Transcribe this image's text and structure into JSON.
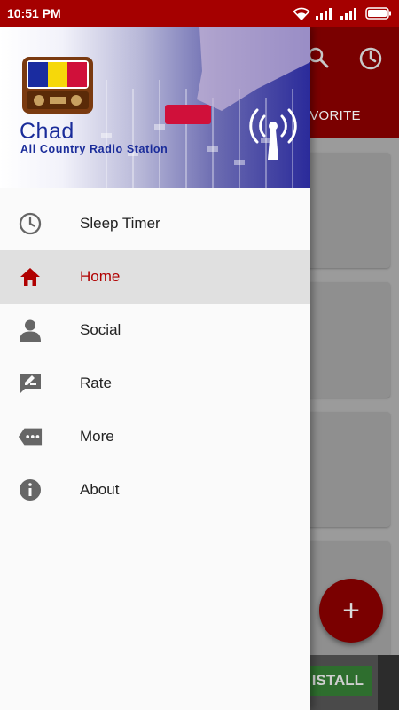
{
  "status_bar": {
    "time": "10:51 PM",
    "icons": [
      "wifi-icon",
      "signal-icon",
      "signal-icon",
      "battery-icon"
    ]
  },
  "background": {
    "tab_label": "AVORITE",
    "fab_label": "+",
    "ad_button_label": "ISTALL",
    "colors": {
      "toolbar": "#a50000",
      "fab": "#b00000"
    }
  },
  "drawer": {
    "app_title": "Chad",
    "app_subtitle": "All Country Radio Station",
    "menu": [
      {
        "label": "Sleep Timer",
        "icon": "clock-icon",
        "active": false
      },
      {
        "label": "Home",
        "icon": "home-icon",
        "active": true
      },
      {
        "label": "Social",
        "icon": "person-icon",
        "active": false
      },
      {
        "label": "Rate",
        "icon": "rate-icon",
        "active": false
      },
      {
        "label": "More",
        "icon": "more-icon",
        "active": false
      },
      {
        "label": "About",
        "icon": "info-icon",
        "active": false
      }
    ]
  },
  "colors": {
    "accent": "#b00000",
    "icon_gray": "#666666",
    "title_blue": "#1a2c9a"
  }
}
